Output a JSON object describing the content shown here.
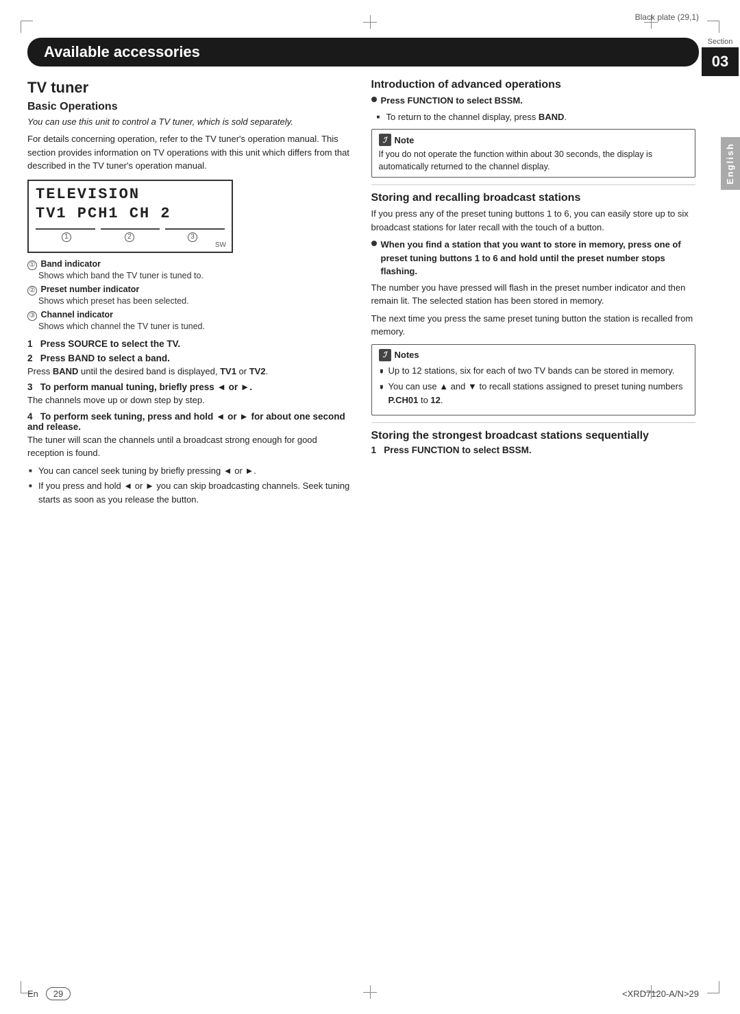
{
  "header": {
    "black_plate": "Black plate (29,1)",
    "section_label": "Section",
    "section_number": "03",
    "english_tab": "English"
  },
  "banner": {
    "title": "Available accessories"
  },
  "left_column": {
    "main_title": "TV tuner",
    "subsection_title": "Basic Operations",
    "italic_intro": "You can use this unit to control a TV tuner, which is sold separately.",
    "intro_para": "For details concerning operation, refer to the TV tuner's operation manual. This section provides information on TV operations with this unit which differs from that described in the TV tuner's operation manual.",
    "display": {
      "line1": "TELEVISION",
      "line2": "TV1  PCH1  CH  2",
      "sw_label": "SW",
      "labels": [
        "1",
        "2",
        "3"
      ]
    },
    "indicators": [
      {
        "num": "①",
        "label": "Band indicator",
        "sub": "Shows which band the TV tuner is tuned to."
      },
      {
        "num": "②",
        "label": "Preset number indicator",
        "sub": "Shows which preset has been selected."
      },
      {
        "num": "③",
        "label": "Channel indicator",
        "sub": "Shows which channel the TV tuner is tuned."
      }
    ],
    "steps": [
      {
        "num": "1",
        "title": "Press SOURCE to select the TV."
      },
      {
        "num": "2",
        "title": "Press BAND to select a band.",
        "para": "Press BAND until the desired band is displayed, TV1 or TV2."
      },
      {
        "num": "3",
        "title": "To perform manual tuning, briefly press ◄ or ►.",
        "para": "The channels move up or down step by step."
      },
      {
        "num": "4",
        "title": "To perform seek tuning, press and hold ◄ or ► for about one second and release.",
        "para": "The tuner will scan the channels until a broadcast strong enough for good reception is found."
      }
    ],
    "bullet_items": [
      "You can cancel seek tuning by briefly pressing ◄ or ►.",
      "If you press and hold ◄ or ► you can skip broadcasting channels. Seek tuning starts as soon as you release the button."
    ]
  },
  "right_column": {
    "intro_section": {
      "title": "Introduction of advanced operations",
      "bullet_bold": "Press FUNCTION to select BSSM.",
      "sub_bullet": "To return to the channel display, press BAND.",
      "note": {
        "label": "Note",
        "icon": "ℐ",
        "text": "If you do not operate the function within about 30 seconds, the display is automatically returned to the channel display."
      }
    },
    "storing_section": {
      "title": "Storing and recalling broadcast stations",
      "para1": "If you press any of the preset tuning buttons 1 to 6, you can easily store up to six broadcast stations for later recall with the touch of a button.",
      "bold_bullet": "When you find a station that you want to store in memory, press one of preset tuning buttons 1 to 6 and hold until the preset number stops flashing.",
      "para2": "The number you have pressed will flash in the preset number indicator and then remain lit. The selected station has been stored in memory.",
      "para3": "The next time you press the same preset tuning button the station is recalled from memory.",
      "notes_label": "Notes",
      "notes": [
        "Up to 12 stations, six for each of two TV bands can be stored in memory.",
        "You can use ▲ and ▼ to recall stations assigned to preset tuning numbers P.CH01 to 12."
      ]
    },
    "strongest_section": {
      "title": "Storing the strongest broadcast stations sequentially",
      "step1_title": "Press FUNCTION to select BSSM."
    }
  },
  "footer": {
    "en_label": "En",
    "page_number": "29",
    "model": "<XRD7120-A/N>29"
  }
}
